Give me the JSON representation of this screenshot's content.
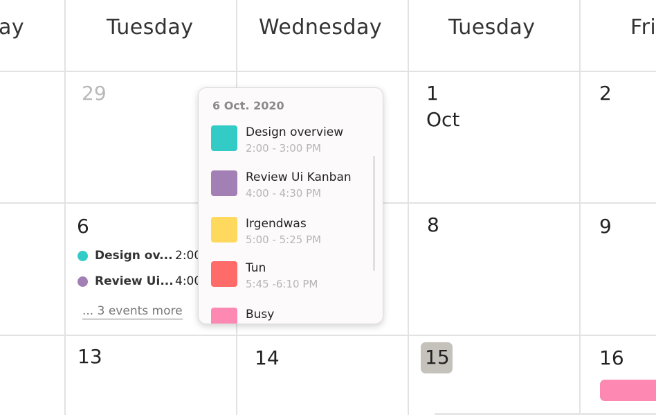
{
  "header": {
    "days": [
      "ay",
      "Tuesday",
      "Wednesday",
      "Tuesday",
      "Fri"
    ]
  },
  "week1": {
    "dates": [
      "29",
      "1",
      "2"
    ],
    "month_label": "Oct"
  },
  "week2": {
    "dates": [
      "6",
      "8",
      "9"
    ],
    "events": [
      {
        "title": "Design ov...",
        "time": "2:00",
        "color": "#33cbc6"
      },
      {
        "title": "Review Ui...",
        "time": "4:00",
        "color": "#a27fb4"
      }
    ],
    "more_link": "... 3 events more"
  },
  "week3": {
    "dates": [
      "13",
      "14",
      "15",
      "16"
    ],
    "today": "15",
    "today_color": "#c4c2ba"
  },
  "popup": {
    "date": "6 Oct. 2020",
    "events": [
      {
        "title": "Design overview",
        "time": "2:00 - 3:00 PM",
        "color": "#33cbc6"
      },
      {
        "title": "Review Ui Kanban",
        "time": "4:00 - 4:30 PM",
        "color": "#a27fb4"
      },
      {
        "title": "Irgendwas",
        "time": "5:00 - 5:25 PM",
        "color": "#ffd95e"
      },
      {
        "title": "Tun",
        "time": "5:45 -6:10 PM",
        "color": "#fe6b68"
      },
      {
        "title": "Busy",
        "time": "",
        "color": "#fd88b1"
      }
    ]
  },
  "colors": {
    "grid_line": "#e2e2e2",
    "busy_bar": "#fd88b1"
  }
}
